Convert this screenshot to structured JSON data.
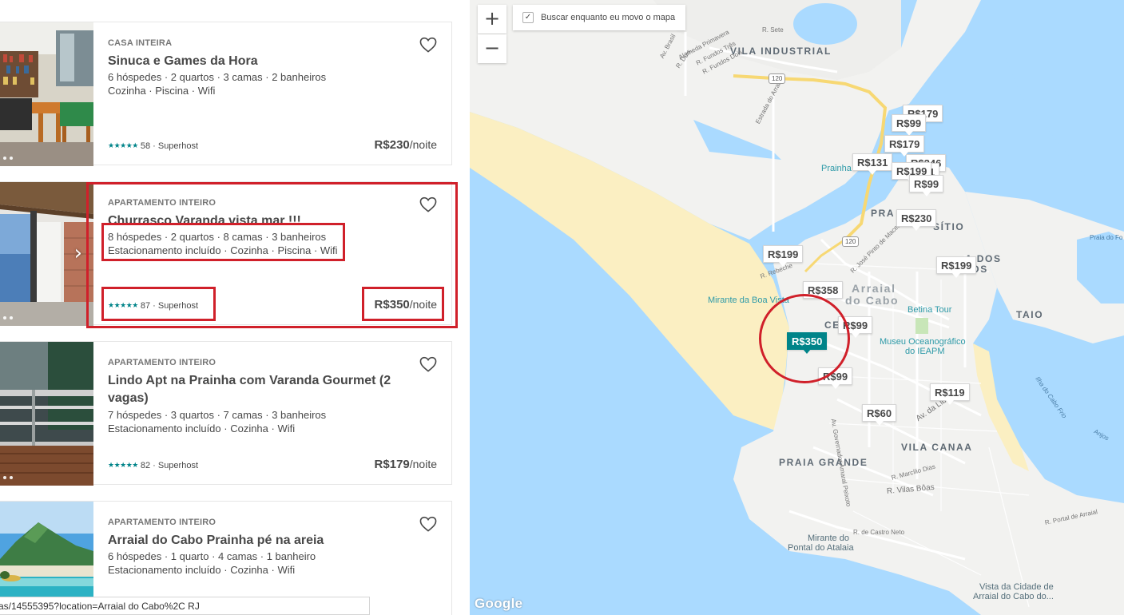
{
  "listings": [
    {
      "type": "CASA INTEIRA",
      "title": "Sinuca e Games da Hora",
      "line1": "6 hóspedes · 2 quartos · 3 camas · 2 banheiros",
      "line2": "Cozinha · Piscina · Wifi",
      "stars": "★★★★★",
      "rating": "58 · Superhost",
      "price": "R$230",
      "unit": "/noite"
    },
    {
      "type": "APARTAMENTO INTEIRO",
      "title": "Churrasco Varanda vista mar !!!",
      "line1": "8 hóspedes · 2 quartos · 8 camas · 3 banheiros",
      "line2": "Estacionamento incluído · Cozinha · Piscina · Wifi",
      "stars": "★★★★★",
      "rating": "87 · Superhost",
      "price": "R$350",
      "unit": "/noite"
    },
    {
      "type": "APARTAMENTO INTEIRO",
      "title": "Lindo Apt na Prainha com Varanda Gourmet (2 vagas)",
      "line1": "7 hóspedes · 3 quartos · 7 camas · 3 banheiros",
      "line2": "Estacionamento incluído · Cozinha · Wifi",
      "stars": "★★★★★",
      "rating": "82 · Superhost",
      "price": "R$179",
      "unit": "/noite"
    },
    {
      "type": "APARTAMENTO INTEIRO",
      "title": "Arraial do Cabo Prainha pé na areia",
      "line1": "6 hóspedes · 1 quarto · 4 camas · 1 banheiro",
      "line2": "Estacionamento incluído · Cozinha · Wifi",
      "stars": "",
      "rating": "",
      "price": "",
      "unit": ""
    }
  ],
  "status_url": "as/14555395?location=Arraial do Cabo%2C RJ",
  "map": {
    "zoom_in": "+",
    "zoom_out": "−",
    "search_move_label": "Buscar enquanto eu movo o mapa",
    "search_move_check": "✓",
    "attribution": "Google",
    "pins": [
      "R$179",
      "R$99",
      "R$179",
      "R$131",
      "R$199",
      "R$99",
      "R$230",
      "R$199",
      "R$199",
      "R$358",
      "R$99",
      "R$350",
      "R$99",
      "R$119",
      "R$60"
    ],
    "pin_fragments": [
      "R$246",
      "111"
    ],
    "areas": [
      "VILA INDUSTRIAL",
      "PRA",
      "SÍTIO",
      "A DOS",
      "JOS",
      "Arraial",
      "do Cabo",
      "CE",
      "TAIO",
      "PRAIA GRANDE",
      "VILA CANAA"
    ],
    "pois": [
      "Prainha",
      "Mirante da Boa Vista",
      "Betina Tour",
      "Museu Oceanográfico",
      "do IEAPM",
      "Mirante do",
      "Pontal do Atalaia",
      "Vista da Cidade de",
      "Arraial do Cabo do..."
    ],
    "roads": [
      "Av. Brasil",
      "Alameda Primavera",
      "R. Sete",
      "R. Fundos Três",
      "R. Fundos Dois",
      "R. Dois",
      "Estrada do Arraial",
      "R. Rebeche",
      "Av. Governador Amaral Peixoto",
      "R. José Pinto de Macedo",
      "Av. da Liberdade",
      "R. Marcílio Dias",
      "R. Vilas Bôas",
      "R. de Castro Neto",
      "R. Portal de Arraial",
      "Ilha do Cabo Frio",
      "Praia do Fo",
      "Anjos"
    ],
    "highway": "120",
    "colors": {
      "water": "#aadaff",
      "land": "#f2f2f0",
      "sand": "#fbefc2",
      "pin_active": "#008489",
      "annotation": "#d0202a"
    }
  }
}
